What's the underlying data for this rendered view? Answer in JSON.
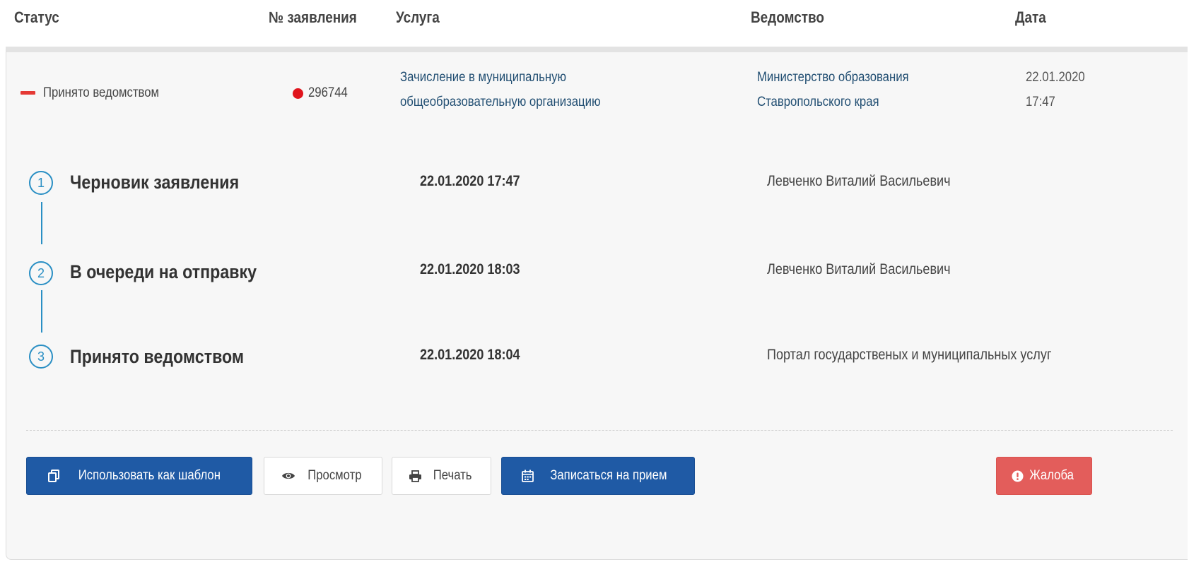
{
  "header": {
    "status": "Статус",
    "number": "№ заявления",
    "service": "Услуга",
    "agency": "Ведомство",
    "date": "Дата"
  },
  "row": {
    "status": "Принято ведомством",
    "number": "296744",
    "service_line1": "Зачисление в муниципальную",
    "service_line2": "общеобразовательную организацию",
    "agency_line1": "Министерство образования",
    "agency_line2": "Ставропольского края",
    "date_line1": "22.01.2020",
    "date_line2": "17:47"
  },
  "steps": [
    {
      "num": "1",
      "title": "Черновик заявления",
      "datetime": "22.01.2020 17:47",
      "person": "Левченко Виталий Васильевич"
    },
    {
      "num": "2",
      "title": "В очереди на отправку",
      "datetime": "22.01.2020 18:03",
      "person": "Левченко Виталий Васильевич"
    },
    {
      "num": "3",
      "title": "Принято ведомством",
      "datetime": "22.01.2020 18:04",
      "person": "Портал государственых и муниципальных услуг"
    }
  ],
  "actions": {
    "template": "Использовать как шаблон",
    "view": "Просмотр",
    "print": "Печать",
    "appointment": "Записаться на прием",
    "complaint": "Жалоба"
  },
  "icons": {
    "status": "minus-icon",
    "number": "dot-icon",
    "template": "copy-icon",
    "view": "eye-icon",
    "print": "print-icon",
    "appointment": "calendar-icon",
    "complaint": "exclamation-circle-icon"
  },
  "colors": {
    "primary": "#1f5aa5",
    "danger": "#e35d5b",
    "status_red": "#e53935",
    "link": "#214e72",
    "step_accent": "#2a8fc4"
  }
}
